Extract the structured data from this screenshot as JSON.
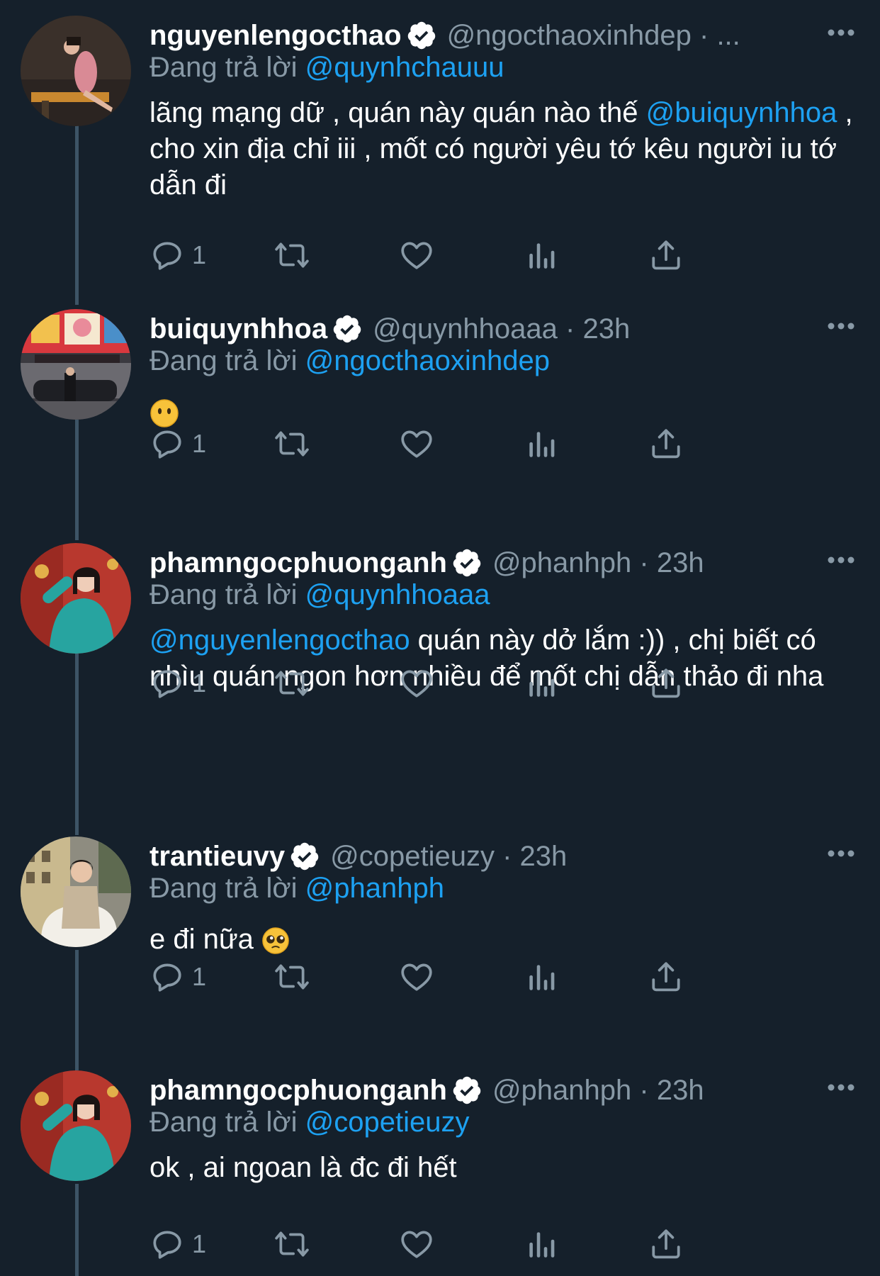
{
  "icons": {
    "verified": "verified-badge-icon",
    "more": "more-options-icon",
    "reply": "reply-icon",
    "retweet": "retweet-icon",
    "like": "like-icon",
    "analytics": "analytics-icon",
    "share": "share-icon",
    "emoji_no_mouth": "face-without-mouth-emoji",
    "emoji_pleading": "pleading-face-emoji"
  },
  "colors": {
    "background": "#15202b",
    "link": "#1da1f2",
    "secondary_text": "#8899a6",
    "thread_line": "#3d5466"
  },
  "tweets": [
    {
      "name": "nguyenlengocthao",
      "handle": "@ngocthaoxinhdep · ...",
      "reply_prefix": "Đang trả lời",
      "reply_to": "@quynhchauuu",
      "text_1": "lãng mạng dữ , quán này quán nào thế",
      "mention": "@buiquynhhoa",
      "text_2": " , cho xin địa chỉ iii , mốt có người yêu tớ kêu người iu tớ dẫn đi",
      "reply_count": "1"
    },
    {
      "name": "buiquynhhoa",
      "handle": "@quynhhoaaa · 23h",
      "reply_prefix": "Đang trả lời",
      "reply_to": "@ngocthaoxinhdep",
      "reply_count": "1"
    },
    {
      "name": "phamngocphuonganh",
      "handle": "@phanhph · 23h",
      "reply_prefix": "Đang trả lời",
      "reply_to": "@quynhhoaaa",
      "mention": "@nguyenlengocthao",
      "text_1": " quán này dở lắm :)) , chị biết có nhìu quán ngon hơn nhiều để mốt chị dẫn thảo đi nha",
      "reply_count": "1"
    },
    {
      "name": "trantieuvy",
      "handle": "@copetieuzy · 23h",
      "reply_prefix": "Đang trả lời",
      "reply_to": "@phanhph",
      "text_1": "e đi nữa ",
      "reply_count": "1"
    },
    {
      "name": "phamngocphuonganh",
      "handle": "@phanhph · 23h",
      "reply_prefix": "Đang trả lời",
      "reply_to": "@copetieuzy",
      "text_1": "ok , ai ngoan là đc đi hết",
      "reply_count": "1"
    }
  ]
}
